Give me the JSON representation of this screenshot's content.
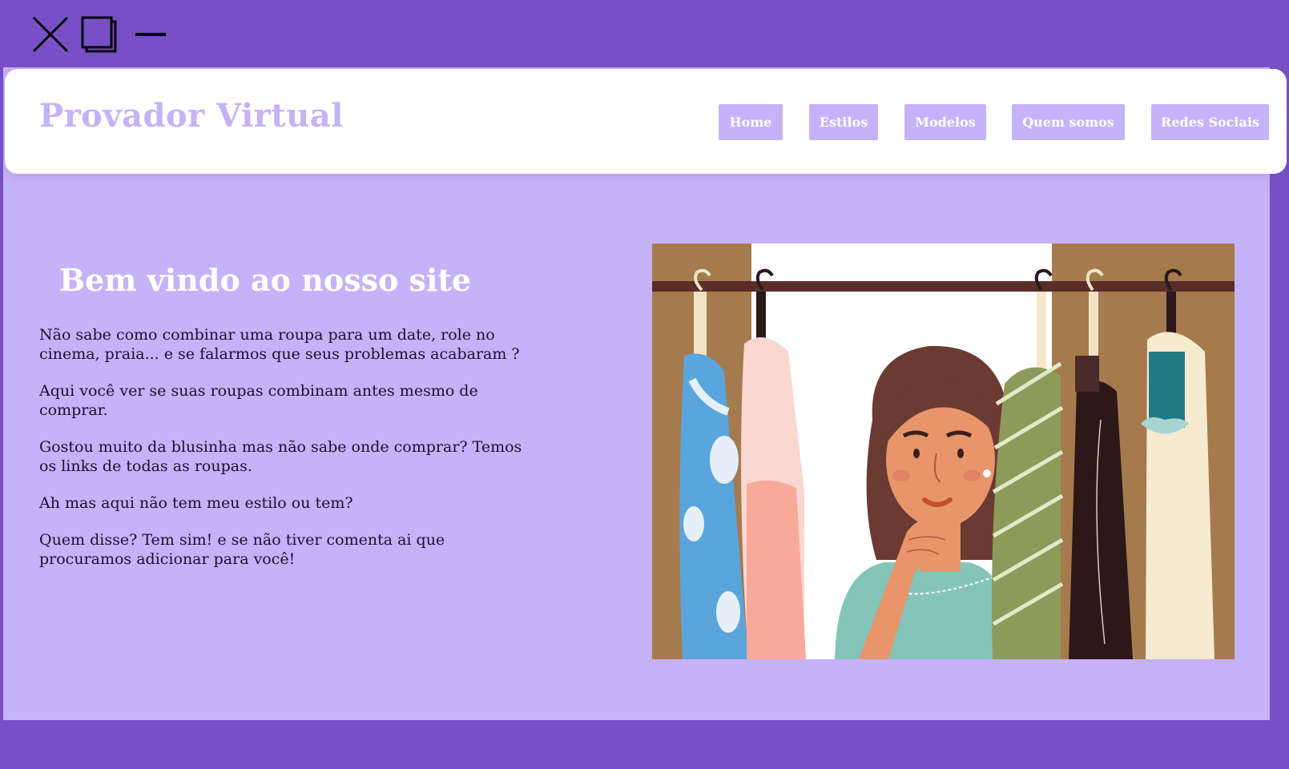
{
  "window": {
    "controls": [
      "close-icon",
      "maximize-icon",
      "minimize-icon"
    ],
    "frame_color": "#7850c6"
  },
  "header": {
    "brand": "Provador Virtual",
    "nav": [
      "Home",
      "Estilos",
      "Modelos",
      "Quem somos",
      "Redes Sociais"
    ]
  },
  "hero": {
    "title": "Bem vindo ao nosso site",
    "paragraphs": [
      "Não sabe como combinar uma roupa para um date, role no cinema, praia... e se falarmos que seus problemas acabaram ?",
      "Aqui você ver se suas roupas combinam antes mesmo de comprar.",
      "Gostou muito da blusinha mas não sabe onde comprar? Temos os links de todas as roupas.",
      "Ah mas aqui não tem meu estilo ou tem?",
      "Quem disse? Tem sim! e se não tiver comenta ai que procuramos adicionar para você!"
    ],
    "illustration": "woman-choosing-clothes-illustration"
  },
  "colors": {
    "accent": "#7850c6",
    "lavender": "#c6b2f8",
    "white": "#ffffff"
  }
}
